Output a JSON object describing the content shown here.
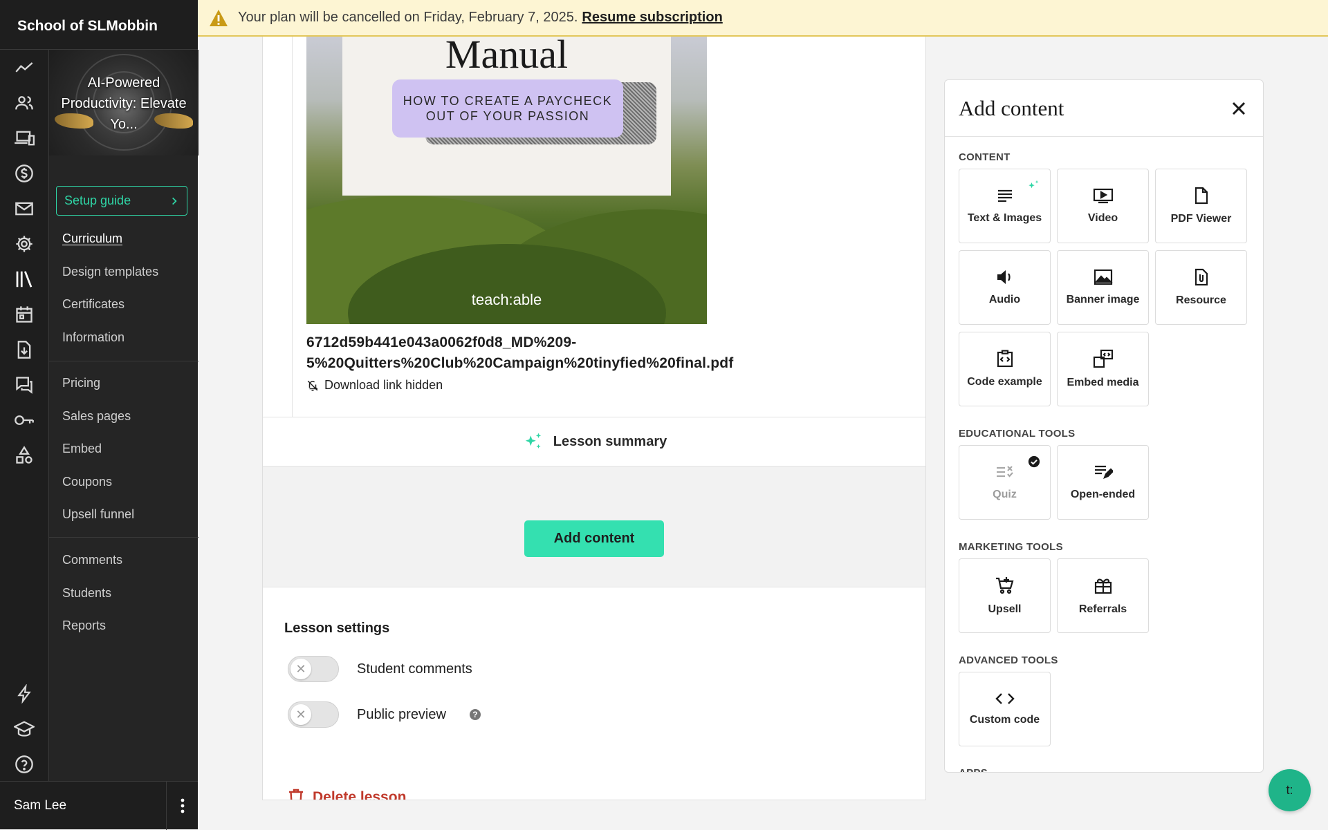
{
  "app": {
    "school_name": "School of SLMobbin"
  },
  "banner": {
    "message": "Your plan will be cancelled on Friday, February 7, 2025.",
    "link": "Resume subscription",
    "color": "#fdf5d3"
  },
  "rail": {
    "icons": [
      "analytics-icon",
      "users-icon",
      "devices-icon",
      "dollar-icon",
      "mail-icon",
      "gear-icon",
      "library-icon",
      "calendar-icon",
      "download-icon",
      "chat-icon",
      "key-icon",
      "shapes-icon"
    ],
    "bottom_icons": [
      "lightning-icon",
      "graduation-cap-icon",
      "help-icon"
    ]
  },
  "sidebar": {
    "course_title": "AI-Powered Productivity: Elevate Yo...",
    "setup_guide": "Setup guide",
    "group1": [
      "Curriculum",
      "Design templates",
      "Certificates",
      "Information"
    ],
    "group2": [
      "Pricing",
      "Sales pages",
      "Embed",
      "Coupons",
      "Upsell funnel"
    ],
    "group3": [
      "Comments",
      "Students",
      "Reports"
    ],
    "active_item": "Curriculum"
  },
  "user": {
    "name": "Sam Lee"
  },
  "lesson": {
    "pdf_cover": {
      "heading": "Manual",
      "pill_text": "HOW TO CREATE A PAYCHECK OUT OF YOUR PASSION",
      "brand": "teach:able"
    },
    "pdf_filename": "6712d59b441e043a0062f0d8_MD%209-5%20Quitters%20Club%20Campaign%20tinyfied%20final.pdf",
    "download_status": "Download link hidden",
    "summary_label": "Lesson summary",
    "add_content_button": "Add content",
    "settings_title": "Lesson settings",
    "toggles": [
      {
        "label": "Student comments",
        "on": false
      },
      {
        "label": "Public preview",
        "on": false
      }
    ],
    "delete_label": "Delete lesson"
  },
  "panel": {
    "title": "Add content",
    "sections": {
      "content": {
        "label": "CONTENT",
        "items": [
          "Text & Images",
          "Video",
          "PDF Viewer",
          "Audio",
          "Banner image",
          "Resource",
          "Code example",
          "Embed media"
        ]
      },
      "educational": {
        "label": "EDUCATIONAL TOOLS",
        "items": [
          "Quiz",
          "Open-ended"
        ]
      },
      "marketing": {
        "label": "MARKETING TOOLS",
        "items": [
          "Upsell",
          "Referrals"
        ]
      },
      "advanced": {
        "label": "ADVANCED TOOLS",
        "items": [
          "Custom code"
        ]
      },
      "apps": {
        "label": "APPS"
      }
    },
    "accent_color": "#34e0b0"
  },
  "chat": {
    "label": "t:"
  }
}
